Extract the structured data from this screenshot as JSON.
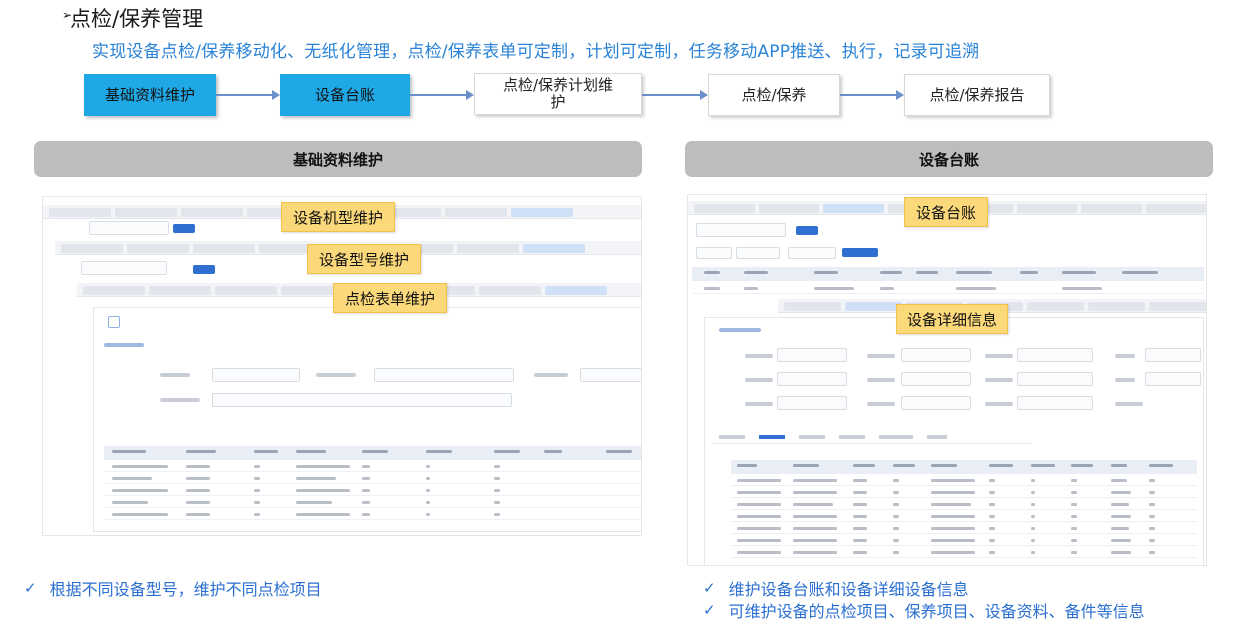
{
  "header": {
    "marker": "➢",
    "title": "点检/保养管理",
    "subtitle": "实现设备点检/保养移动化、无纸化管理，点检/保养表单可定制，计划可定制，任务移动APP推送、执行，记录可追溯"
  },
  "flow": {
    "steps": [
      {
        "label": "基础资料维护",
        "active": true
      },
      {
        "label": "设备台账",
        "active": true
      },
      {
        "label": "点检/保养计划维护",
        "active": false
      },
      {
        "label": "点检/保养",
        "active": false
      },
      {
        "label": "点检/保养报告",
        "active": false
      }
    ],
    "active_color": "#1ea9e6"
  },
  "left_section": {
    "header": "基础资料维护",
    "callouts": [
      "设备机型维护",
      "设备型号维护",
      "点检表单维护"
    ],
    "note": "根据不同设备型号，维护不同点检项目"
  },
  "right_section": {
    "header": "设备台账",
    "callouts": [
      "设备台账",
      "设备详细信息"
    ],
    "notes": [
      "维护设备台账和设备详细设备信息",
      "可维护设备的点检项目、保养项目、设备资料、备件等信息"
    ]
  },
  "check_mark": "✓",
  "colors": {
    "accent_blue": "#2a83d6",
    "callout_yellow": "#fbd97a",
    "section_grey": "#bdbdbd"
  }
}
